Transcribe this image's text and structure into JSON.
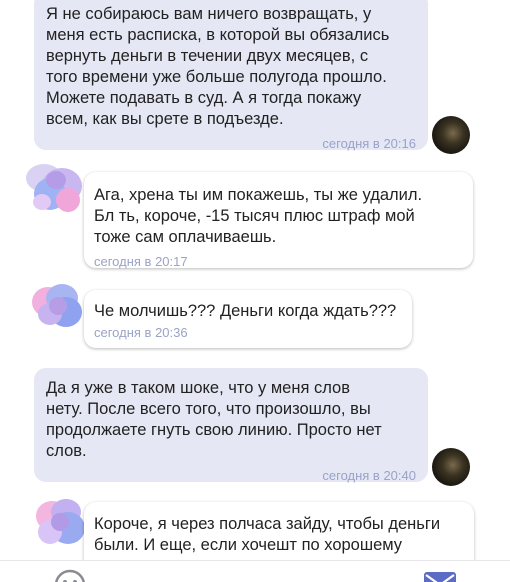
{
  "messages": [
    {
      "text": "Я не собираюсь вам ничего возвращать, у\nменя есть расписка, в которой вы обязались\nвернуть деньги в течении двух месяцев, с\nтого времени уже больше полугода прошло.\nМожете подавать в суд. А я тогда покажу\nвсем, как вы срете в подъезде.",
      "time": "сегодня в 20:16"
    },
    {
      "text": "Ага, хрена ты им покажешь, ты же удалил.\nБл  ть, короче, -15 тысяч плюс штраф мой\nтоже сам оплачиваешь.",
      "time": "сегодня в 20:17"
    },
    {
      "text": "Че молчишь??? Деньги когда ждать???",
      "time": "сегодня в 20:36"
    },
    {
      "text": "Да я уже в таком шоке, что у меня слов\nнету. После всего того, что произошло, вы\nпродолжаете гнуть свою линию. Просто нет\nслов.",
      "time": "сегодня в 20:40"
    },
    {
      "text": "Короче, я через полчаса зайду, чтобы деньги\nбыли. И еще, если хочешт по хорошему"
    }
  ],
  "icons": {
    "emoji": "emoji-icon",
    "send": "send-icon"
  },
  "colors": {
    "outgoing_bubble": "#e5e7f4",
    "incoming_bubble": "#ffffff",
    "timestamp": "#9aa3c8",
    "accent": "#5b6cc4"
  }
}
